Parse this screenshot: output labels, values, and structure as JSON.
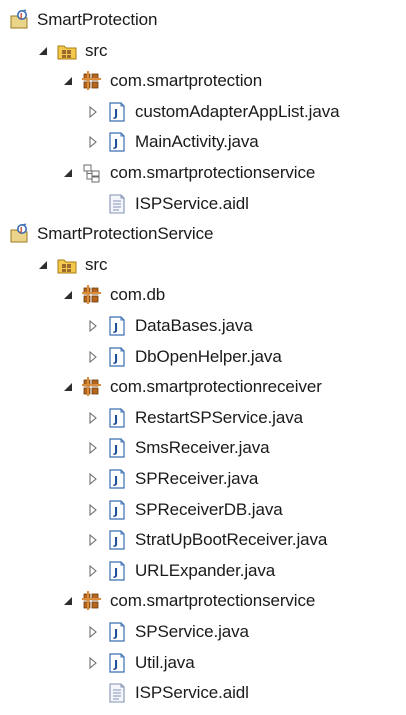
{
  "tree": [
    {
      "label": "SmartProtection",
      "icon": "java-project-icon",
      "level": 0,
      "twisty": "none"
    },
    {
      "label": "src",
      "icon": "source-folder-icon",
      "level": 1,
      "twisty": "expanded"
    },
    {
      "label": "com.smartprotection",
      "icon": "package-icon",
      "level": 2,
      "twisty": "expanded"
    },
    {
      "label": "customAdapterAppList.java",
      "icon": "java-file-icon",
      "level": 3,
      "twisty": "collapsed"
    },
    {
      "label": "MainActivity.java",
      "icon": "java-file-icon",
      "level": 3,
      "twisty": "collapsed"
    },
    {
      "label": "com.smartprotectionservice",
      "icon": "package-hierarchy-icon",
      "level": 2,
      "twisty": "expanded"
    },
    {
      "label": "ISPService.aidl",
      "icon": "aidl-file-icon",
      "level": 3,
      "twisty": "none"
    },
    {
      "label": "SmartProtectionService",
      "icon": "java-project-icon",
      "level": 0,
      "twisty": "none"
    },
    {
      "label": "src",
      "icon": "source-folder-icon",
      "level": 1,
      "twisty": "expanded"
    },
    {
      "label": "com.db",
      "icon": "package-icon",
      "level": 2,
      "twisty": "expanded"
    },
    {
      "label": "DataBases.java",
      "icon": "java-file-icon",
      "level": 3,
      "twisty": "collapsed"
    },
    {
      "label": "DbOpenHelper.java",
      "icon": "java-file-icon",
      "level": 3,
      "twisty": "collapsed"
    },
    {
      "label": "com.smartprotectionreceiver",
      "icon": "package-icon",
      "level": 2,
      "twisty": "expanded"
    },
    {
      "label": "RestartSPService.java",
      "icon": "java-file-icon",
      "level": 3,
      "twisty": "collapsed"
    },
    {
      "label": "SmsReceiver.java",
      "icon": "java-file-icon",
      "level": 3,
      "twisty": "collapsed"
    },
    {
      "label": "SPReceiver.java",
      "icon": "java-file-icon",
      "level": 3,
      "twisty": "collapsed"
    },
    {
      "label": "SPReceiverDB.java",
      "icon": "java-file-icon",
      "level": 3,
      "twisty": "collapsed"
    },
    {
      "label": "StratUpBootReceiver.java",
      "icon": "java-file-icon",
      "level": 3,
      "twisty": "collapsed"
    },
    {
      "label": "URLExpander.java",
      "icon": "java-file-icon",
      "level": 3,
      "twisty": "collapsed"
    },
    {
      "label": "com.smartprotectionservice",
      "icon": "package-icon",
      "level": 2,
      "twisty": "expanded"
    },
    {
      "label": "SPService.java",
      "icon": "java-file-icon",
      "level": 3,
      "twisty": "collapsed"
    },
    {
      "label": "Util.java",
      "icon": "java-file-icon",
      "level": 3,
      "twisty": "collapsed"
    },
    {
      "label": "ISPService.aidl",
      "icon": "aidl-file-icon",
      "level": 3,
      "twisty": "none"
    }
  ]
}
